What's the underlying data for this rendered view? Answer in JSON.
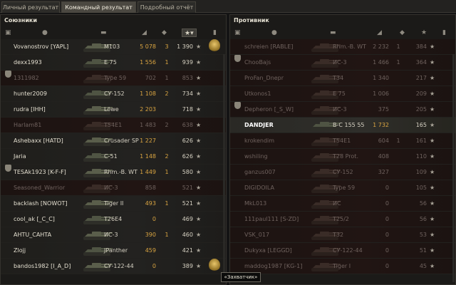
{
  "tabs": [
    {
      "label": "Личный результат",
      "active": false
    },
    {
      "label": "Командный результат",
      "active": true
    },
    {
      "label": "Подробный отчёт",
      "active": false
    }
  ],
  "allies": {
    "title": "Союзники",
    "rows": [
      {
        "player": "Vovanostrov [YAPL]",
        "tank": "M103",
        "damage": "5 078",
        "kills": "3",
        "xp": "1 390",
        "dead": false,
        "clan_icon": false,
        "badge": true
      },
      {
        "player": "dexx1993",
        "tank": "E 75",
        "damage": "1 556",
        "kills": "1",
        "xp": "939",
        "dead": false,
        "clan_icon": false,
        "badge": false
      },
      {
        "player": "1311982",
        "tank": "Type 59",
        "damage": "702",
        "kills": "1",
        "xp": "853",
        "dead": true,
        "clan_icon": true,
        "badge": false
      },
      {
        "player": "hunter2009",
        "tank": "СУ-152",
        "damage": "1 108",
        "kills": "2",
        "xp": "734",
        "dead": false,
        "clan_icon": false,
        "badge": false
      },
      {
        "player": "rudra [IHH]",
        "tank": "Löwe",
        "damage": "2 203",
        "kills": "",
        "xp": "718",
        "dead": false,
        "clan_icon": false,
        "badge": false
      },
      {
        "player": "Harlam81",
        "tank": "T54E1",
        "damage": "1 483",
        "kills": "2",
        "xp": "638",
        "dead": true,
        "clan_icon": false,
        "badge": false
      },
      {
        "player": "Ashebaxx [HATD]",
        "tank": "Crusader SP",
        "damage": "1 227",
        "kills": "",
        "xp": "626",
        "dead": false,
        "clan_icon": false,
        "badge": false
      },
      {
        "player": "Jaria",
        "tank": "С-51",
        "damage": "1 148",
        "kills": "2",
        "xp": "626",
        "dead": false,
        "clan_icon": false,
        "badge": false
      },
      {
        "player": "TESAk1923 [K-F-F]",
        "tank": "Rhm.-B. WT",
        "damage": "1 449",
        "kills": "1",
        "xp": "580",
        "dead": false,
        "clan_icon": true,
        "badge": false
      },
      {
        "player": "Seasoned_Warrior",
        "tank": "ИС-3",
        "damage": "858",
        "kills": "",
        "xp": "521",
        "dead": true,
        "clan_icon": false,
        "badge": false
      },
      {
        "player": "backlash [NOWOT]",
        "tank": "Tiger II",
        "damage": "493",
        "kills": "1",
        "xp": "521",
        "dead": false,
        "clan_icon": false,
        "badge": false
      },
      {
        "player": "cool_ak [_C_C]",
        "tank": "T26E4",
        "damage": "0",
        "kills": "",
        "xp": "469",
        "dead": false,
        "clan_icon": false,
        "badge": false
      },
      {
        "player": "AHTU_CAHTA",
        "tank": "ИС-3",
        "damage": "390",
        "kills": "1",
        "xp": "460",
        "dead": false,
        "clan_icon": false,
        "badge": false
      },
      {
        "player": "Zlojj",
        "tank": "JPanther",
        "damage": "459",
        "kills": "",
        "xp": "421",
        "dead": false,
        "clan_icon": false,
        "badge": false
      },
      {
        "player": "bandos1982 [I_A_D]",
        "tank": "СУ-122-44",
        "damage": "0",
        "kills": "",
        "xp": "389",
        "dead": false,
        "clan_icon": false,
        "badge": true
      }
    ]
  },
  "enemies": {
    "title": "Противник",
    "rows": [
      {
        "player": "schreien [RABLE]",
        "tank": "Rhm.-B. WT",
        "damage": "2 232",
        "kills": "1",
        "xp": "384",
        "dead": true,
        "clan_icon": false,
        "me": false
      },
      {
        "player": "ChooBajs",
        "tank": "ИС-3",
        "damage": "1 466",
        "kills": "1",
        "xp": "364",
        "dead": true,
        "clan_icon": true,
        "me": false
      },
      {
        "player": "ProFan_Dnepr",
        "tank": "T34",
        "damage": "1 340",
        "kills": "",
        "xp": "217",
        "dead": true,
        "clan_icon": false,
        "me": false
      },
      {
        "player": "Utkonos1",
        "tank": "E 75",
        "damage": "1 006",
        "kills": "",
        "xp": "209",
        "dead": true,
        "clan_icon": false,
        "me": false
      },
      {
        "player": "Depheron [_S_W]",
        "tank": "ИС-3",
        "damage": "375",
        "kills": "",
        "xp": "205",
        "dead": true,
        "clan_icon": true,
        "me": false
      },
      {
        "player": "DANDJER",
        "tank": "В-С 155 55",
        "damage": "1 732",
        "kills": "",
        "xp": "165",
        "dead": false,
        "clan_icon": false,
        "me": true
      },
      {
        "player": "krokendim",
        "tank": "T54E1",
        "damage": "604",
        "kills": "1",
        "xp": "161",
        "dead": true,
        "clan_icon": false,
        "me": false
      },
      {
        "player": "wshiling",
        "tank": "T28 Prot.",
        "damage": "408",
        "kills": "",
        "xp": "110",
        "dead": true,
        "clan_icon": false,
        "me": false
      },
      {
        "player": "ganzus007",
        "tank": "СУ-152",
        "damage": "327",
        "kills": "",
        "xp": "109",
        "dead": true,
        "clan_icon": false,
        "me": false
      },
      {
        "player": "DIGIDOILA",
        "tank": "Type 59",
        "damage": "0",
        "kills": "",
        "xp": "105",
        "dead": true,
        "clan_icon": false,
        "me": false
      },
      {
        "player": "MkL013",
        "tank": "ИС",
        "damage": "0",
        "kills": "",
        "xp": "56",
        "dead": true,
        "clan_icon": false,
        "me": false
      },
      {
        "player": "111paul111 [S-ZD]",
        "tank": "T25/2",
        "damage": "0",
        "kills": "",
        "xp": "56",
        "dead": true,
        "clan_icon": false,
        "me": false
      },
      {
        "player": "VSK_017",
        "tank": "T32",
        "damage": "0",
        "kills": "",
        "xp": "53",
        "dead": true,
        "clan_icon": false,
        "me": false
      },
      {
        "player": "Dukyxa [LEGGD]",
        "tank": "СУ-122-44",
        "damage": "0",
        "kills": "",
        "xp": "51",
        "dead": true,
        "clan_icon": false,
        "me": false
      },
      {
        "player": "maddog1987 [KG-1]",
        "tank": "Tiger I",
        "damage": "0",
        "kills": "",
        "xp": "45",
        "dead": true,
        "clan_icon": false,
        "me": false
      }
    ]
  },
  "tooltip": "«Захватчик»",
  "colors": {
    "damage": "#d9a441",
    "dead_row": "#211513",
    "text": "#c9c4b4"
  },
  "header_icons": [
    "squad-icon",
    "player-icon",
    "tank-icon",
    "damage-icon",
    "kills-icon",
    "xp-star-icon",
    "medal-icon"
  ]
}
